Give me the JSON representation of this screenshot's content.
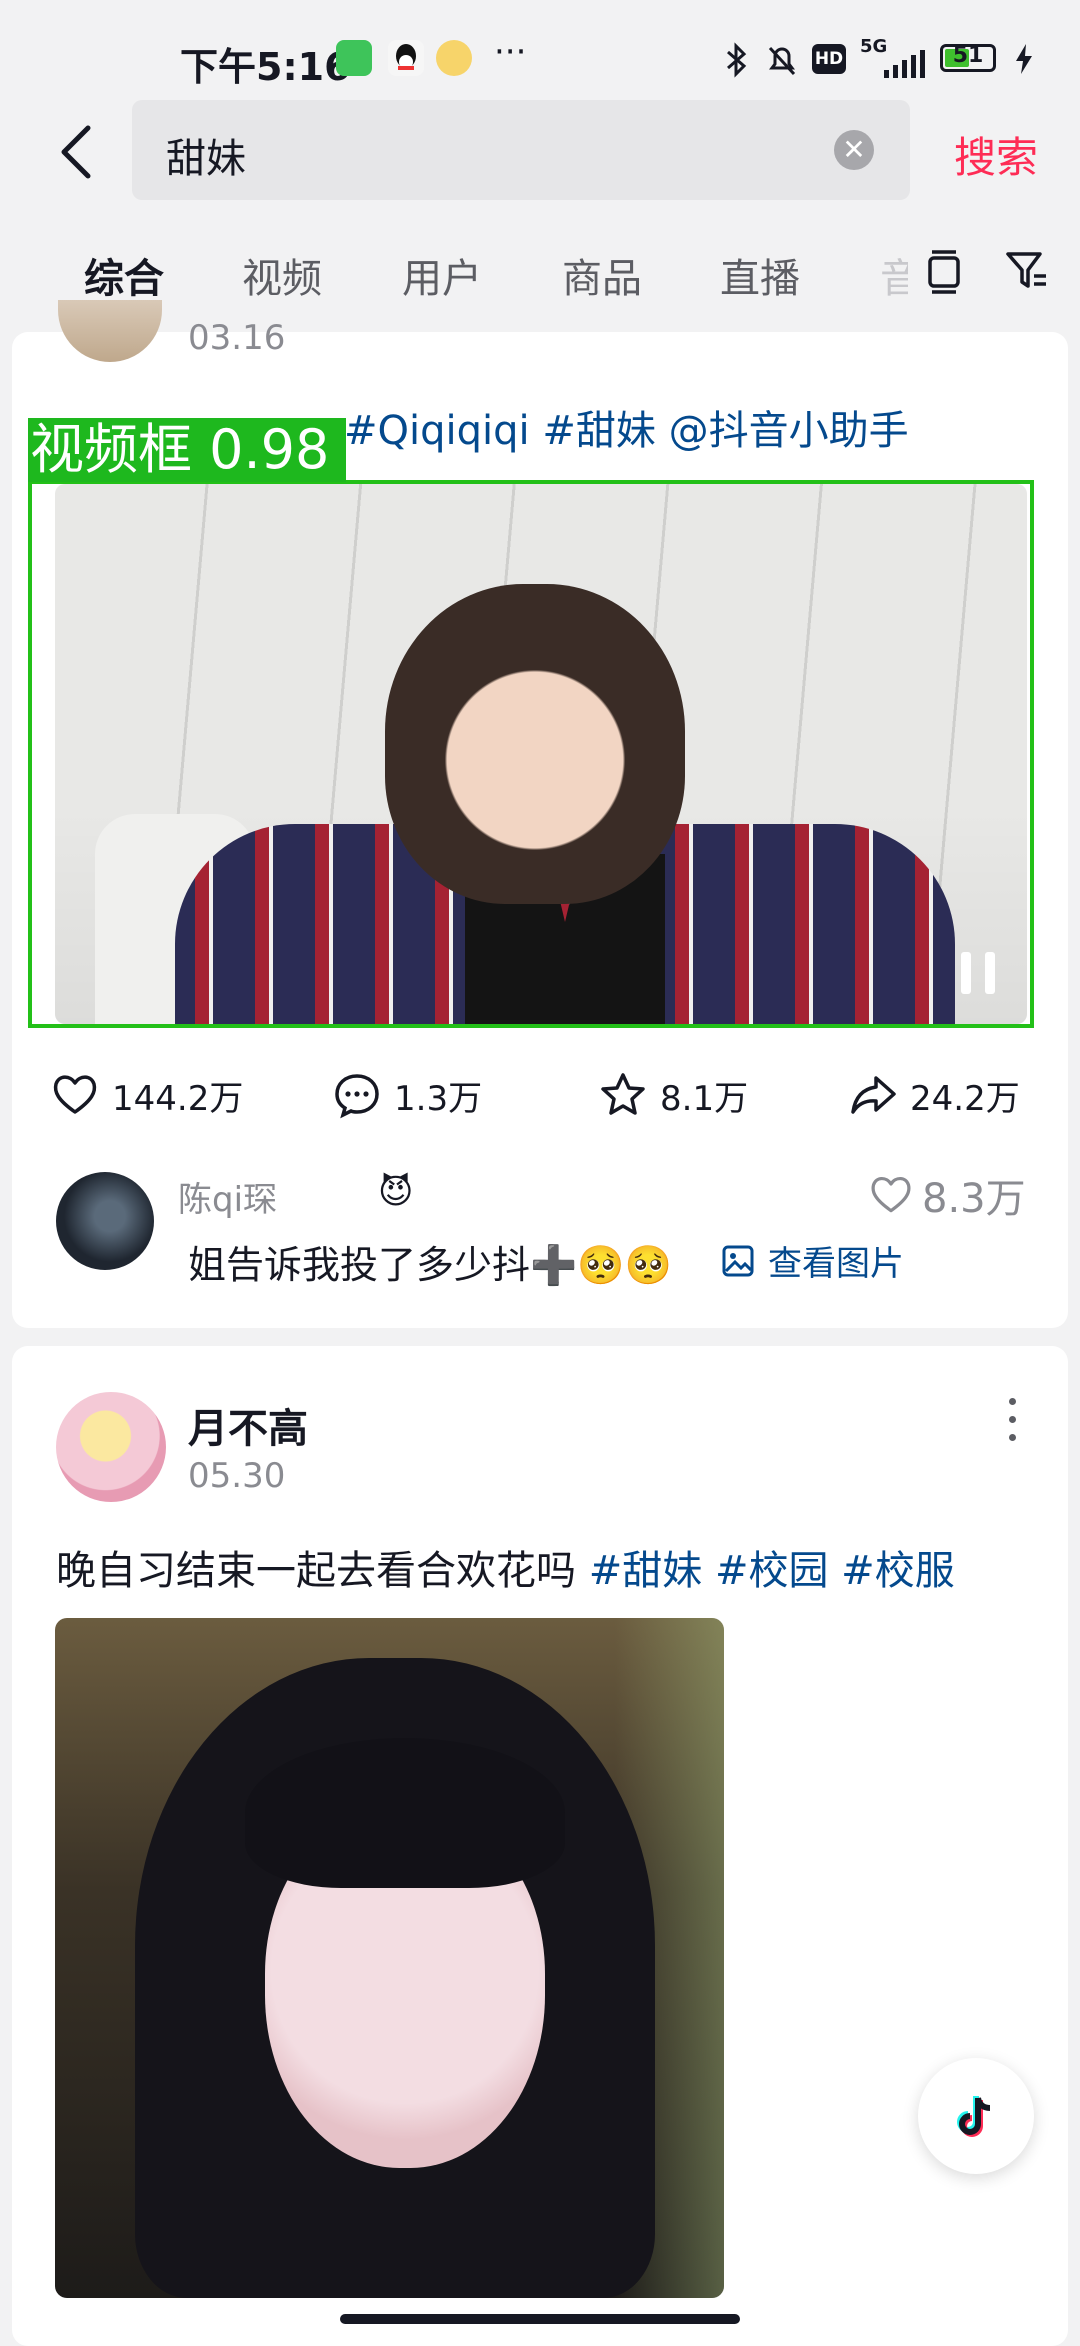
{
  "status_bar": {
    "time": "下午5:16",
    "network": "5G",
    "hd": "HD",
    "battery": "51",
    "more": "···"
  },
  "search": {
    "query": "甜妹",
    "action_label": "搜索"
  },
  "tabs": [
    "综合",
    "视频",
    "用户",
    "商品",
    "直播",
    "音"
  ],
  "post1": {
    "date": "03.16",
    "caption_tags": "#Qiqiqiqi #甜妹 @抖音小助手",
    "detection_label": "视频框 0.98",
    "stats": {
      "likes": "144.2万",
      "comments": "1.3万",
      "favorites": "8.1万",
      "shares": "24.2万"
    },
    "top_comment": {
      "user": "陈qi琛",
      "user_emoji": "😈",
      "likes": "8.3万",
      "text": "姐告诉我投了多少抖➕🥺🥺",
      "image_link": "查看图片"
    }
  },
  "post2": {
    "author": "月不高",
    "date": "05.30",
    "caption_text": "晚自习结束一起去看合欢花吗",
    "caption_tags": "#甜妹 #校园 #校服"
  },
  "colors": {
    "accent": "#fe2c55",
    "link": "#04498d",
    "detection": "#23c018"
  },
  "icons": [
    "back-icon",
    "clear-icon",
    "layout-icon",
    "filter-icon",
    "heart-icon",
    "comment-icon",
    "star-icon",
    "share-icon",
    "image-icon",
    "more-icon",
    "tiktok-icon"
  ]
}
